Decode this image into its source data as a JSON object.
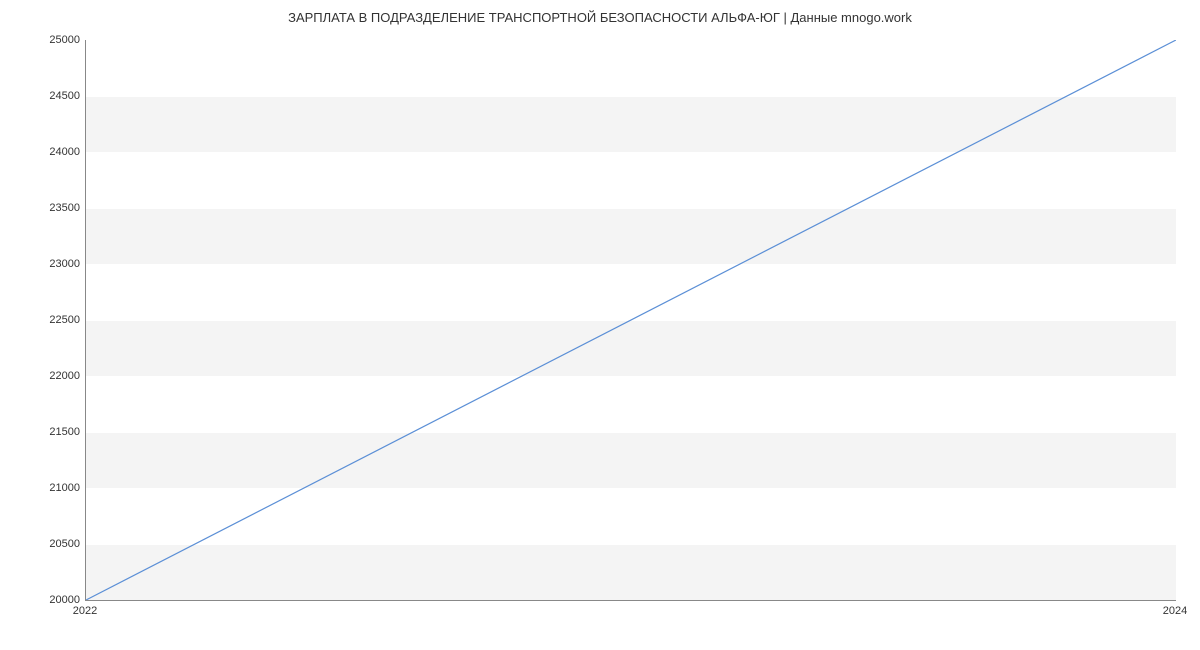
{
  "chart_data": {
    "type": "line",
    "title": "ЗАРПЛАТА В  ПОДРАЗДЕЛЕНИЕ ТРАНСПОРТНОЙ БЕЗОПАСНОСТИ АЛЬФА-ЮГ | Данные mnogo.work",
    "x": [
      2022,
      2024
    ],
    "values": [
      20000,
      25000
    ],
    "xlabel": "",
    "ylabel": "",
    "xlim": [
      2022,
      2024
    ],
    "ylim": [
      20000,
      25000
    ],
    "y_ticks": [
      20000,
      20500,
      21000,
      21500,
      22000,
      22500,
      23000,
      23500,
      24000,
      24500,
      25000
    ],
    "x_ticks": [
      2022,
      2024
    ],
    "line_color": "#5b8fd6"
  }
}
